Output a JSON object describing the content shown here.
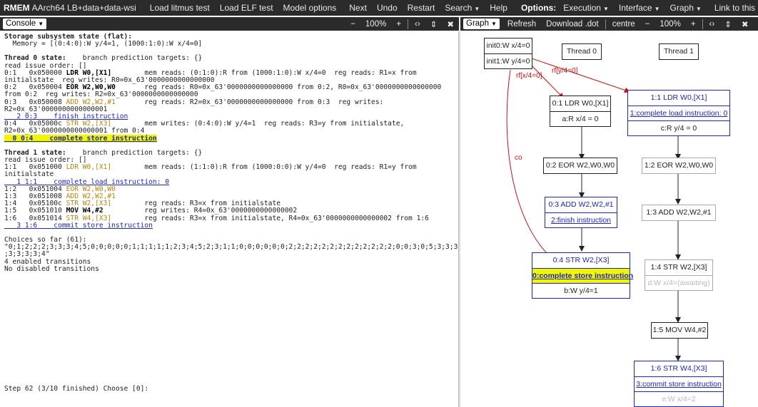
{
  "colors": {
    "toolbar": "#2b2b2b",
    "link": "#1c25c8",
    "instr": "#b8860b",
    "highlight": "#f1f600",
    "rf_edge": "#d01010"
  },
  "topbar": {
    "brand": "RMEM",
    "test_name": "AArch64 LB+data+data-wsi",
    "load_litmus": "Load litmus test",
    "load_elf": "Load ELF test",
    "model_options": "Model options",
    "next": "Next",
    "undo": "Undo",
    "restart": "Restart",
    "search": "Search",
    "help": "Help",
    "options_label": "Options:",
    "execution": "Execution",
    "interface": "Interface",
    "graph": "Graph",
    "link": "Link to this state"
  },
  "console_bar": {
    "select": "Console",
    "minus": "−",
    "zoom": "100%",
    "plus": "+",
    "code_icon": "‹›",
    "updown_icon": "⇕",
    "close": "✖"
  },
  "graph_bar": {
    "select": "Graph",
    "refresh": "Refresh",
    "download": "Download .dot",
    "centre": "centre",
    "minus": "−",
    "zoom": "100%",
    "plus": "+",
    "code_icon": "‹›",
    "updown_icon": "⇕",
    "close": "✖"
  },
  "console": {
    "storage_title": "Storage subsystem state (flat):",
    "memory": "  Memory = [(0:4:0):W y/4=1, (1000:1:0):W x/4=0]",
    "t0_title": "Thread 0 state:",
    "t0_bp": "    branch prediction targets: {}",
    "t0_order": "read issue order: []",
    "t0_l1a": "0:1   0x050000 ",
    "t0_l1b": "LDR W0,[X1]",
    "t0_l1c": "        mem reads: (0:1:0):R from (1000:1:0):W x/4=0  reg reads: R1=x from",
    "t0_l1d": "initialstate  reg writes: R0=0x_63'0000000000000000",
    "t0_l2a": "0:2   0x050004 ",
    "t0_l2b": "EOR W2,W0,W0",
    "t0_l2c": "       reg reads: R0=0x_63'0000000000000000 from 0:2, R0=0x_63'0000000000000000",
    "t0_l2d": "from 0:2  reg writes: R2=0x_63'0000000000000000",
    "t0_l3a": "0:3   0x050008 ",
    "t0_l3b": "ADD W2,W2,#1",
    "t0_l3c": "       reg reads: R2=0x_63'0000000000000000 from 0:3  reg writes:",
    "t0_l3d": "R2=0x_63'0000000000000001",
    "t0_l3e": "   2 0:3    finish instruction",
    "t0_l4a": "0:4   0x05000c ",
    "t0_l4b": "STR W2,[X3]",
    "t0_l4c": "        mem writes: (0:4:0):W y/4=1  reg reads: R3=y from initialstate,",
    "t0_l4d": "R2=0x_63'0000000000000001 from 0:4",
    "t0_l4e": "  0 0:4    complete store instruction",
    "t1_title": "Thread 1 state:",
    "t1_bp": "    branch prediction targets: {}",
    "t1_order": "read issue order: []",
    "t1_l1a": "1:1   0x051000 ",
    "t1_l1b": "LDR W0,[X1]",
    "t1_l1c": "        mem reads: (1:1:0):R from (1000:0:0):W y/4=0  reg reads: R1=y from",
    "t1_l1d": "initialstate",
    "t1_l1e": "   1 1:1    complete load instruction: 0",
    "t1_l2a": "1:2   0x051004 ",
    "t1_l2b": "EOR W2,W0,W0",
    "t1_l3a": "1:3   0x051008 ",
    "t1_l3b": "ADD W2,W2,#1",
    "t1_l4a": "1:4   0x05100c ",
    "t1_l4b": "STR W2,[X3]",
    "t1_l4c": "        reg reads: R3=x from initialstate",
    "t1_l5a": "1:5   0x051010 ",
    "t1_l5b": "MOV W4,#2",
    "t1_l5c": "          reg writes: R4=0x_63'0000000000000002",
    "t1_l6a": "1:6   0x051014 ",
    "t1_l6b": "STR W4,[X3]",
    "t1_l6c": "        reg reads: R3=x from initialstate, R4=0x_63'0000000000000002 from 1:6",
    "t1_l6e": "   3 1:6    commit store instruction",
    "choices_title": "Choices so far (61):",
    "choices_1": "\"0;1;2;2;2;3;3;3;4;5;0;0;0;0;0;1;1;1;1;1;2;3;4;5;2;3;1;1;0;0;0;0;0;0;2;2;2;2;2;2;2;2;2;2;2;2;2;0;0;3;0;5;3;3;3;3",
    "choices_2": ";3;3;3;3;4\"",
    "enabled": "4 enabled transitions",
    "disabled": "No disabled transitions",
    "step": "Step 62 (3/10 finished) Choose [0]:"
  },
  "graph": {
    "init0": "init0:W x/4=0",
    "init1": "init1:W y/4=0",
    "thread0": "Thread 0",
    "thread1": "Thread 1",
    "n01_instr": "0:1 LDR W0,[X1]",
    "n01_ev": "a:R x/4 = 0",
    "n02_instr": "0:2 EOR W2,W0,W0",
    "n03_instr": "0:3 ADD W2,W2,#1",
    "n03_tr": "2:finish instruction",
    "n04_instr": "0:4 STR W2,[X3]",
    "n04_tr": "0:complete store instruction",
    "n04_ev": "b:W y/4=1",
    "n11_instr": "1:1 LDR W0,[X1]",
    "n11_tr": "1:complete load instruction: 0",
    "n11_ev": "c:R y/4 = 0",
    "n12_instr": "1:2 EOR W2,W0,W0",
    "n13_instr": "1:3 ADD W2,W2,#1",
    "n14_instr": "1:4 STR W2,[X3]",
    "n14_ev": "d:W x/4=(awaiting)",
    "n15_instr": "1:5 MOV W4,#2",
    "n16_instr": "1:6 STR W4,[X3]",
    "n16_tr": "3:commit store instruction",
    "n16_ev": "e:W x/4=2",
    "rf_x": "rf[x/4=0]",
    "rf_y": "rf[y/4=0]",
    "co": "co"
  }
}
